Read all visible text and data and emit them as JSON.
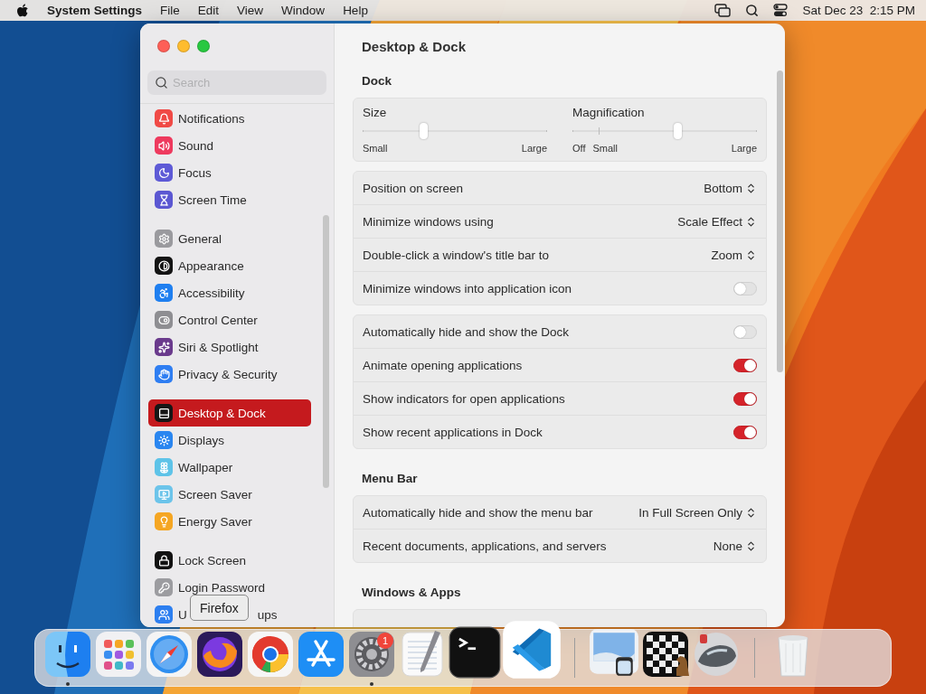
{
  "menu_bar": {
    "app_name": "System Settings",
    "menus": [
      "File",
      "Edit",
      "View",
      "Window",
      "Help"
    ],
    "clock": "Sat Dec 23  2:15 PM"
  },
  "window": {
    "title": "Desktop & Dock",
    "search": {
      "placeholder": "Search"
    },
    "sidebar": {
      "groups": [
        [
          {
            "label": "Notifications",
            "selected": false,
            "color": "#f04a46"
          },
          {
            "label": "Sound",
            "selected": false,
            "color": "#ee3a5e"
          },
          {
            "label": "Focus",
            "selected": false,
            "color": "#5e5ad6"
          },
          {
            "label": "Screen Time",
            "selected": false,
            "color": "#5b57d2"
          }
        ],
        [
          {
            "label": "General",
            "selected": false,
            "color": "#9a9a9e"
          },
          {
            "label": "Appearance",
            "selected": false,
            "color": "#141414"
          },
          {
            "label": "Accessibility",
            "selected": false,
            "color": "#1f7ff0"
          },
          {
            "label": "Control Center",
            "selected": false,
            "color": "#8e8e92"
          },
          {
            "label": "Siri & Spotlight",
            "selected": false,
            "color": "#6a3a8c"
          },
          {
            "label": "Privacy & Security",
            "selected": false,
            "color": "#2f7ef2"
          }
        ],
        [
          {
            "label": "Desktop & Dock",
            "selected": true,
            "color": "#161616"
          },
          {
            "label": "Displays",
            "selected": false,
            "color": "#2a86f0"
          },
          {
            "label": "Wallpaper",
            "selected": false,
            "color": "#5ec3e8"
          },
          {
            "label": "Screen Saver",
            "selected": false,
            "color": "#6cc4ea"
          },
          {
            "label": "Energy Saver",
            "selected": false,
            "color": "#f5a623"
          }
        ],
        [
          {
            "label": "Lock Screen",
            "selected": false,
            "color": "#121212"
          },
          {
            "label": "Login Password",
            "selected": false,
            "color": "#9c9ca0"
          },
          {
            "label_parts": [
              "U",
              "ups"
            ],
            "selected": false,
            "color": "#2d7ff0"
          }
        ]
      ]
    },
    "sections": [
      {
        "heading": "Dock",
        "cards": [
          {
            "kind": "sliders",
            "sliders": [
              {
                "label": "Size",
                "level": 0.33,
                "left_labels": [
                  "Small"
                ],
                "right_label": "Large"
              },
              {
                "label": "Magnification",
                "level": 0.57,
                "left_labels": [
                  "Off",
                  "Small"
                ],
                "right_label": "Large",
                "off_stop": true
              }
            ]
          },
          {
            "kind": "rows",
            "rows": [
              {
                "kind": "popup",
                "label": "Position on screen",
                "value": "Bottom"
              },
              {
                "kind": "popup",
                "label": "Minimize windows using",
                "value": "Scale Effect"
              },
              {
                "kind": "popup",
                "label": "Double-click a window's title bar to",
                "value": "Zoom"
              },
              {
                "kind": "toggle",
                "label": "Minimize windows into application icon",
                "on": false
              }
            ]
          },
          {
            "kind": "rows",
            "rows": [
              {
                "kind": "toggle",
                "label": "Automatically hide and show the Dock",
                "on": false
              },
              {
                "kind": "toggle",
                "label": "Animate opening applications",
                "on": true
              },
              {
                "kind": "toggle",
                "label": "Show indicators for open applications",
                "on": true
              },
              {
                "kind": "toggle",
                "label": "Show recent applications in Dock",
                "on": true
              }
            ]
          }
        ]
      },
      {
        "heading": "Menu Bar",
        "cards": [
          {
            "kind": "rows",
            "rows": [
              {
                "kind": "popup",
                "label": "Automatically hide and show the menu bar",
                "value": "In Full Screen Only"
              },
              {
                "kind": "popup",
                "label": "Recent documents, applications, and servers",
                "value": "None"
              }
            ]
          }
        ]
      },
      {
        "heading": "Windows & Apps",
        "cards": [
          {
            "kind": "rows"
          }
        ]
      }
    ]
  },
  "dock": {
    "items": [
      {
        "kind": "app",
        "running": true
      },
      {
        "kind": "app",
        "running": false
      },
      {
        "kind": "app",
        "running": false
      },
      {
        "kind": "app",
        "running": false,
        "tooltip": "Firefox"
      },
      {
        "kind": "app",
        "running": false
      },
      {
        "kind": "app",
        "running": false
      },
      {
        "kind": "app",
        "running": true,
        "badge": "1"
      },
      {
        "kind": "app",
        "running": false
      },
      {
        "kind": "app",
        "running": false
      },
      {
        "kind": "app",
        "running": false
      },
      {
        "kind": "separator"
      },
      {
        "kind": "app",
        "running": false
      },
      {
        "kind": "app",
        "running": false
      },
      {
        "kind": "app",
        "running": false
      },
      {
        "kind": "separator"
      },
      {
        "kind": "app",
        "running": false
      }
    ]
  }
}
